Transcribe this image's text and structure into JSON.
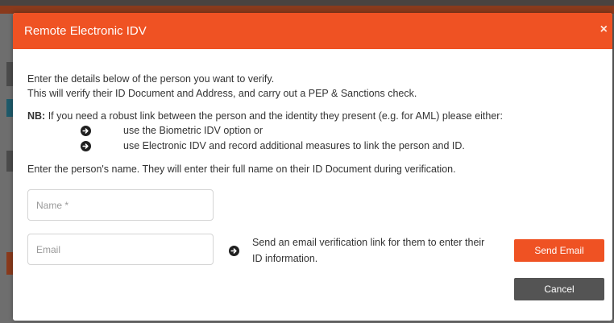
{
  "modal": {
    "title": "Remote Electronic IDV",
    "close_symbol": "×"
  },
  "intro": {
    "line1": "Enter the details below of the person you want to verify.",
    "line2": "This will verify their ID Document and Address, and carry out a PEP & Sanctions check."
  },
  "nb": {
    "label": "NB:",
    "text": "If you need a robust link between the person and the identity they present (e.g. for AML) please either:",
    "options": [
      "use the Biometric IDV option or",
      "use Electronic IDV and record additional measures to link the person and ID."
    ]
  },
  "instruction": "Enter the person's name. They will enter their full name on their ID Document during verification.",
  "form": {
    "name_placeholder": "Name *",
    "email_placeholder": "Email",
    "email_hint_line1": "Send an email verification link for them to enter their",
    "email_hint_line2": "ID information."
  },
  "buttons": {
    "send_email": "Send Email",
    "cancel": "Cancel"
  },
  "icons": {
    "bullet": "arrow-circle-right-icon",
    "close": "close-icon"
  },
  "colors": {
    "accent": "#ef5223",
    "cancel": "#545454",
    "text": "#333333"
  }
}
